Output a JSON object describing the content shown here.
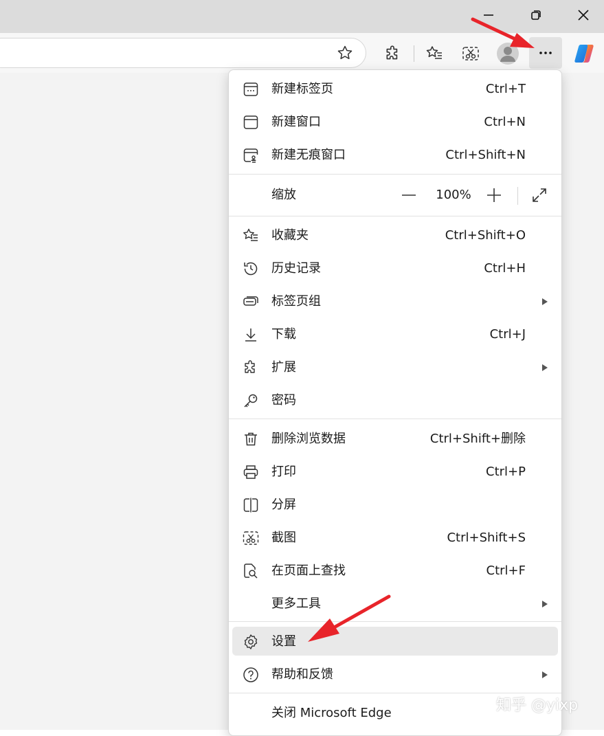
{
  "window": {
    "minimize_icon": "minimize-icon",
    "restore_icon": "restore-icon",
    "close_icon": "close-icon"
  },
  "toolbar": {
    "icons": [
      "star-icon",
      "extensions-icon",
      "favorites-icon",
      "screenshot-icon",
      "profile-avatar",
      "more-icon",
      "copilot-icon"
    ]
  },
  "menu": {
    "group1": [
      {
        "label": "新建标签页",
        "shortcut": "Ctrl+T",
        "icon": "new-tab-icon"
      },
      {
        "label": "新建窗口",
        "shortcut": "Ctrl+N",
        "icon": "new-window-icon"
      },
      {
        "label": "新建无痕窗口",
        "shortcut": "Ctrl+Shift+N",
        "icon": "inprivate-window-icon"
      }
    ],
    "zoom": {
      "label": "缩放",
      "value": "100%"
    },
    "group2": [
      {
        "label": "收藏夹",
        "shortcut": "Ctrl+Shift+O",
        "icon": "favorites-icon"
      },
      {
        "label": "历史记录",
        "shortcut": "Ctrl+H",
        "icon": "history-icon"
      },
      {
        "label": "标签页组",
        "shortcut": "",
        "icon": "tab-groups-icon"
      },
      {
        "label": "下载",
        "shortcut": "Ctrl+J",
        "icon": "download-icon"
      },
      {
        "label": "扩展",
        "shortcut": "",
        "icon": "extensions-icon"
      },
      {
        "label": "密码",
        "shortcut": "",
        "icon": "key-icon"
      }
    ],
    "group3": [
      {
        "label": "删除浏览数据",
        "shortcut": "Ctrl+Shift+删除",
        "icon": "trash-icon"
      },
      {
        "label": "打印",
        "shortcut": "Ctrl+P",
        "icon": "print-icon"
      },
      {
        "label": "分屏",
        "shortcut": "",
        "icon": "split-screen-icon"
      },
      {
        "label": "截图",
        "shortcut": "Ctrl+Shift+S",
        "icon": "screenshot-icon"
      },
      {
        "label": "在页面上查找",
        "shortcut": "Ctrl+F",
        "icon": "find-icon"
      },
      {
        "label": "更多工具",
        "shortcut": "",
        "icon": ""
      }
    ],
    "group4": [
      {
        "label": "设置",
        "shortcut": "",
        "icon": "gear-icon"
      },
      {
        "label": "帮助和反馈",
        "shortcut": "",
        "icon": "help-icon"
      }
    ],
    "group5": [
      {
        "label": "关闭 Microsoft Edge",
        "shortcut": "",
        "icon": ""
      }
    ]
  },
  "watermark": "知乎 @yixp",
  "colors": {
    "annotation_arrow": "#e8242a",
    "highlight": "#e9e9e9",
    "titlebar": "#dcdcdc"
  }
}
